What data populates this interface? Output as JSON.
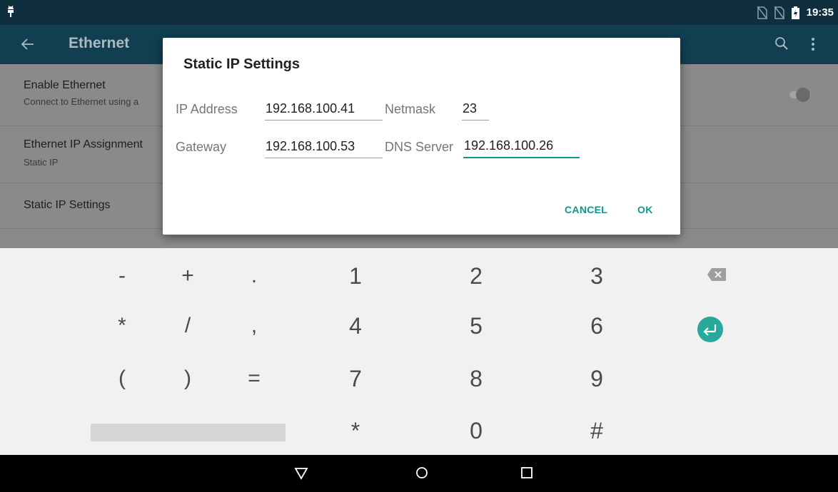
{
  "status_bar": {
    "time": "19:35",
    "left_icon": "android-debug-icon",
    "right_icons": [
      "no-sim-icon",
      "no-sim-icon",
      "battery-charging-icon"
    ]
  },
  "app_bar": {
    "title": "Ethernet",
    "back_icon": "arrow-back-icon",
    "actions": [
      "search-icon",
      "more-vert-icon"
    ]
  },
  "settings": {
    "enable_title": "Enable Ethernet",
    "enable_subtitle": "Connect to Ethernet using a",
    "enable_toggle_on": false,
    "assignment_title": "Ethernet IP Assignment",
    "assignment_subtitle": "Static IP",
    "static_title": "Static IP Settings"
  },
  "dialog": {
    "title": "Static IP Settings",
    "ip_label": "IP Address",
    "ip_value": "192.168.100.41",
    "netmask_label": "Netmask",
    "netmask_value": "23",
    "gateway_label": "Gateway",
    "gateway_value": "192.168.100.53",
    "dns_label": "DNS Server",
    "dns_value": "192.168.100.26",
    "cancel_label": "CANCEL",
    "ok_label": "OK"
  },
  "keyboard": {
    "rows": [
      [
        "-",
        "+",
        ".",
        "1",
        "2",
        "3"
      ],
      [
        "*",
        "/",
        ",",
        "4",
        "5",
        "6"
      ],
      [
        "(",
        ")",
        "=",
        "7",
        "8",
        "9"
      ],
      [
        "*",
        "0",
        "#"
      ]
    ],
    "special_keys": [
      "backspace-icon",
      "enter-icon",
      "space-bar"
    ]
  },
  "nav_bar": {
    "icons": [
      "nav-back-icon",
      "nav-home-icon",
      "nav-recents-icon"
    ]
  },
  "colors": {
    "accent": "#11968a",
    "status_bar": "#0f2f3e",
    "app_bar": "#123e52",
    "scrim": "#8a8a8a"
  }
}
